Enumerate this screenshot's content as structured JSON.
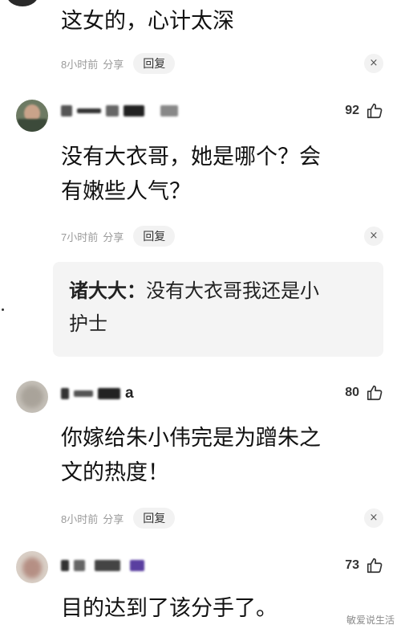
{
  "comments": [
    {
      "text_lines": [
        "这女的，心计太深"
      ],
      "time": "8小时前",
      "share": "分享",
      "reply": "回复",
      "close": "×"
    },
    {
      "likes": "92",
      "text_lines": [
        "没有大衣哥，她是哪个？会",
        "有嫩些人气？"
      ],
      "time": "7小时前",
      "share": "分享",
      "reply": "回复",
      "close": "×",
      "quote": {
        "author": "诸大大：",
        "lines_first": "没有大衣哥我还是小",
        "line_second": "护士"
      }
    },
    {
      "likes": "80",
      "name_suffix": "a",
      "text_lines": [
        "你嫁给朱小伟完是为蹭朱之",
        "文的热度！"
      ],
      "time": "8小时前",
      "share": "分享",
      "reply": "回复",
      "close": "×"
    },
    {
      "likes": "73",
      "text_lines": [
        "目的达到了该分手了。"
      ]
    }
  ],
  "watermark": "敏爱说生活",
  "colors": {
    "meta_gray": "#9a9a9a",
    "reply_bg": "#f2f2f2",
    "quote_bg": "#f4f4f4"
  },
  "icons": {
    "like": "thumbs-up-icon",
    "close": "close-icon"
  }
}
